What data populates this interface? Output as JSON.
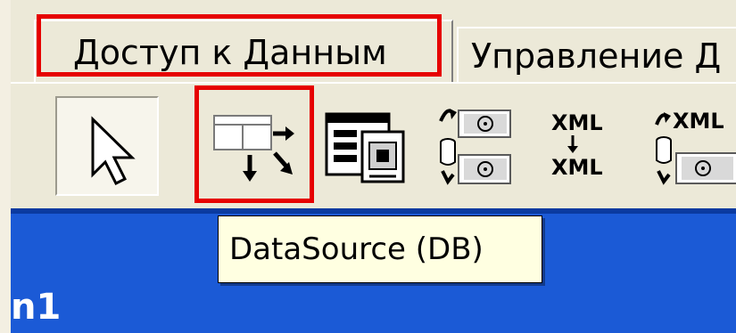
{
  "tabs": [
    {
      "label": "Доступ к Данным",
      "active": true
    },
    {
      "label": "Управление Д",
      "active": false
    }
  ],
  "toolbar": {
    "tools": [
      {
        "name": "pointer",
        "icon": "pointer-arrow-icon"
      },
      {
        "name": "datasource",
        "icon": "datasource-icon",
        "tooltip": "DataSource (DB)"
      },
      {
        "name": "dataview",
        "icon": "data-form-icon"
      },
      {
        "name": "db-cursor",
        "icon": "database-cursor-icon"
      },
      {
        "name": "xml-transform",
        "icon": "xml-transform-icon",
        "xml_top": "XML",
        "xml_bottom": "XML"
      },
      {
        "name": "xml-db",
        "icon": "xml-database-icon",
        "xml_label": "XML"
      }
    ]
  },
  "tooltip": {
    "text": "DataSource (DB)"
  },
  "designer": {
    "title_fragment": "n1"
  },
  "colors": {
    "highlight": "#e60000",
    "tooltip_bg": "#ffffe1",
    "designer_bg": "#1b5ad6"
  }
}
